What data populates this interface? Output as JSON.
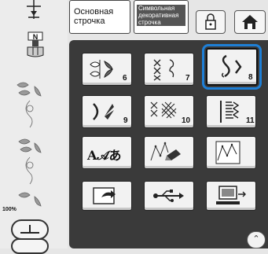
{
  "header": {
    "utility_tab": [
      "Основная",
      "строчка"
    ],
    "decorative_tab": [
      "Символьная",
      "декоративная",
      "строчка"
    ]
  },
  "left": {
    "zoom": "100%"
  },
  "categories": [
    {
      "icon": "satin-leaf-stitch-icon",
      "number": "6"
    },
    {
      "icon": "cross-stitch-icon",
      "number": "7"
    },
    {
      "icon": "decorative-scroll-stitch-icon",
      "number": "8"
    },
    {
      "icon": "stretch-stitch-icon",
      "number": "9"
    },
    {
      "icon": "cross-hatch-stitch-icon",
      "number": "10"
    },
    {
      "icon": "satin-bar-stitch-icon",
      "number": "11"
    },
    {
      "icon": "character-stitch-icon",
      "label": "A𝒜あ"
    },
    {
      "icon": "my-custom-stitch-edit-icon"
    },
    {
      "icon": "my-custom-stitch-grid-icon"
    },
    {
      "icon": "recall-memory-icon"
    },
    {
      "icon": "usb-icon"
    },
    {
      "icon": "computer-icon"
    }
  ],
  "selected_category_index": 2,
  "colors": {
    "panel": "#3a3a3a",
    "selection": "#1e7fd6"
  }
}
